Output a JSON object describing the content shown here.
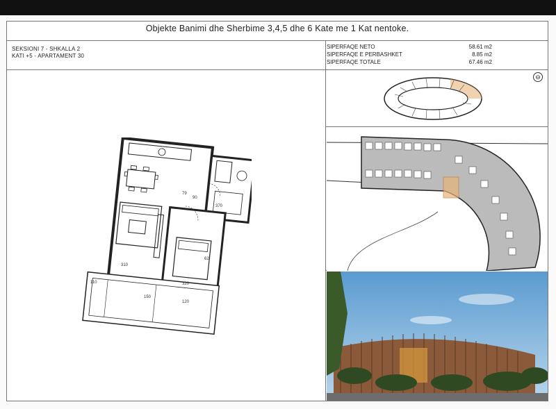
{
  "header": {
    "title": "Objekte Banimi dhe Sherbime 3,4,5 dhe 6 Kate me 1 Kat nentoke."
  },
  "unit": {
    "section_line": "SEKSIONI 7 - SHKALLA 2",
    "floor_line": "KATI +5 - APARTAMENT 30"
  },
  "areas": [
    {
      "label": "SIPERFAQE NETO",
      "value": "58.61 m2"
    },
    {
      "label": "SIPERFAQE E PERBASHKET",
      "value": "8.85 m2"
    },
    {
      "label": "SIPERFAQE TOTALE",
      "value": "67.46 m2"
    }
  ],
  "plan_labels": {
    "dim1": "79",
    "dim2": "90",
    "dim3": "370",
    "dim4": "320",
    "dim5": "310",
    "dim6": "62",
    "dim7": "110",
    "dim8": "150",
    "dim9": "120"
  },
  "colors": {
    "highlight": "#e8b47a",
    "sky": "#7fb2dc",
    "building": "#8a5a3a"
  }
}
